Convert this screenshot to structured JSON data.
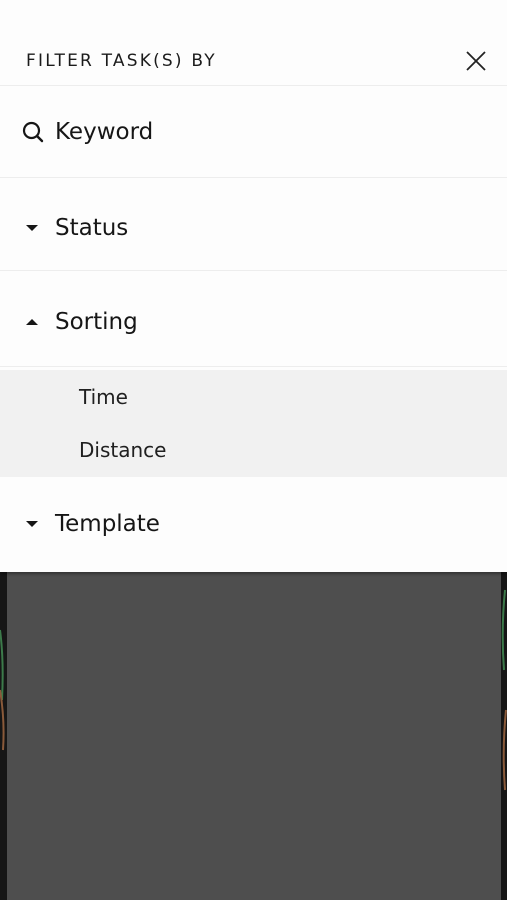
{
  "header": {
    "title": "FILTER TASK(S) BY",
    "close_icon": "close-icon"
  },
  "filters": {
    "keyword": {
      "label": "Keyword",
      "icon": "search-icon"
    },
    "status": {
      "label": "Status",
      "icon": "caret-down-icon",
      "expanded": false
    },
    "sorting": {
      "label": "Sorting",
      "icon": "caret-up-icon",
      "expanded": true,
      "options": [
        {
          "label": "Time"
        },
        {
          "label": "Distance"
        }
      ]
    },
    "template": {
      "label": "Template",
      "icon": "caret-down-icon",
      "expanded": false
    }
  },
  "colors": {
    "panel": "#fdfdfd",
    "text": "#161616",
    "sub_list_bg": "#f1f1f1",
    "overlay": "#4e4e4e",
    "divider": "#ededed"
  }
}
